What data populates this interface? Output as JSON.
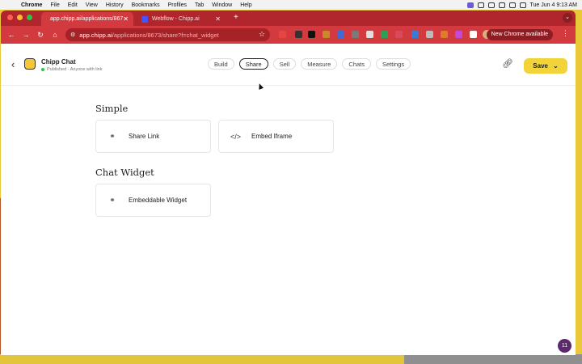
{
  "menubar": {
    "app": "Chrome",
    "items": [
      "File",
      "Edit",
      "View",
      "History",
      "Bookmarks",
      "Profiles",
      "Tab",
      "Window",
      "Help"
    ],
    "clock": "Tue Jun 4  9:13 AM"
  },
  "browser": {
    "tabs": [
      {
        "title": "app.chipp.ai/applications/867",
        "active": true
      },
      {
        "title": "Webflow - Chipp.ai",
        "active": false
      }
    ],
    "url_host": "app.chipp.ai",
    "url_path": "/applications/8673/share?f=chat_widget",
    "new_chrome_label": "New Chrome available"
  },
  "app": {
    "name": "Chipp Chat",
    "status": "Published · Anyone with link",
    "nav": [
      {
        "label": "Build",
        "active": false
      },
      {
        "label": "Share",
        "active": true
      },
      {
        "label": "Sell",
        "active": false
      },
      {
        "label": "Measure",
        "active": false
      },
      {
        "label": "Chats",
        "active": false
      },
      {
        "label": "Settings",
        "active": false
      }
    ],
    "save_label": "Save",
    "accent": "#f2d43a"
  },
  "content": {
    "simple_title": "Simple",
    "share_link": "Share Link",
    "embed_iframe": "Embed Iframe",
    "widget_title": "Chat Widget",
    "embeddable_widget": "Embeddable Widget"
  },
  "notification_count": "11"
}
